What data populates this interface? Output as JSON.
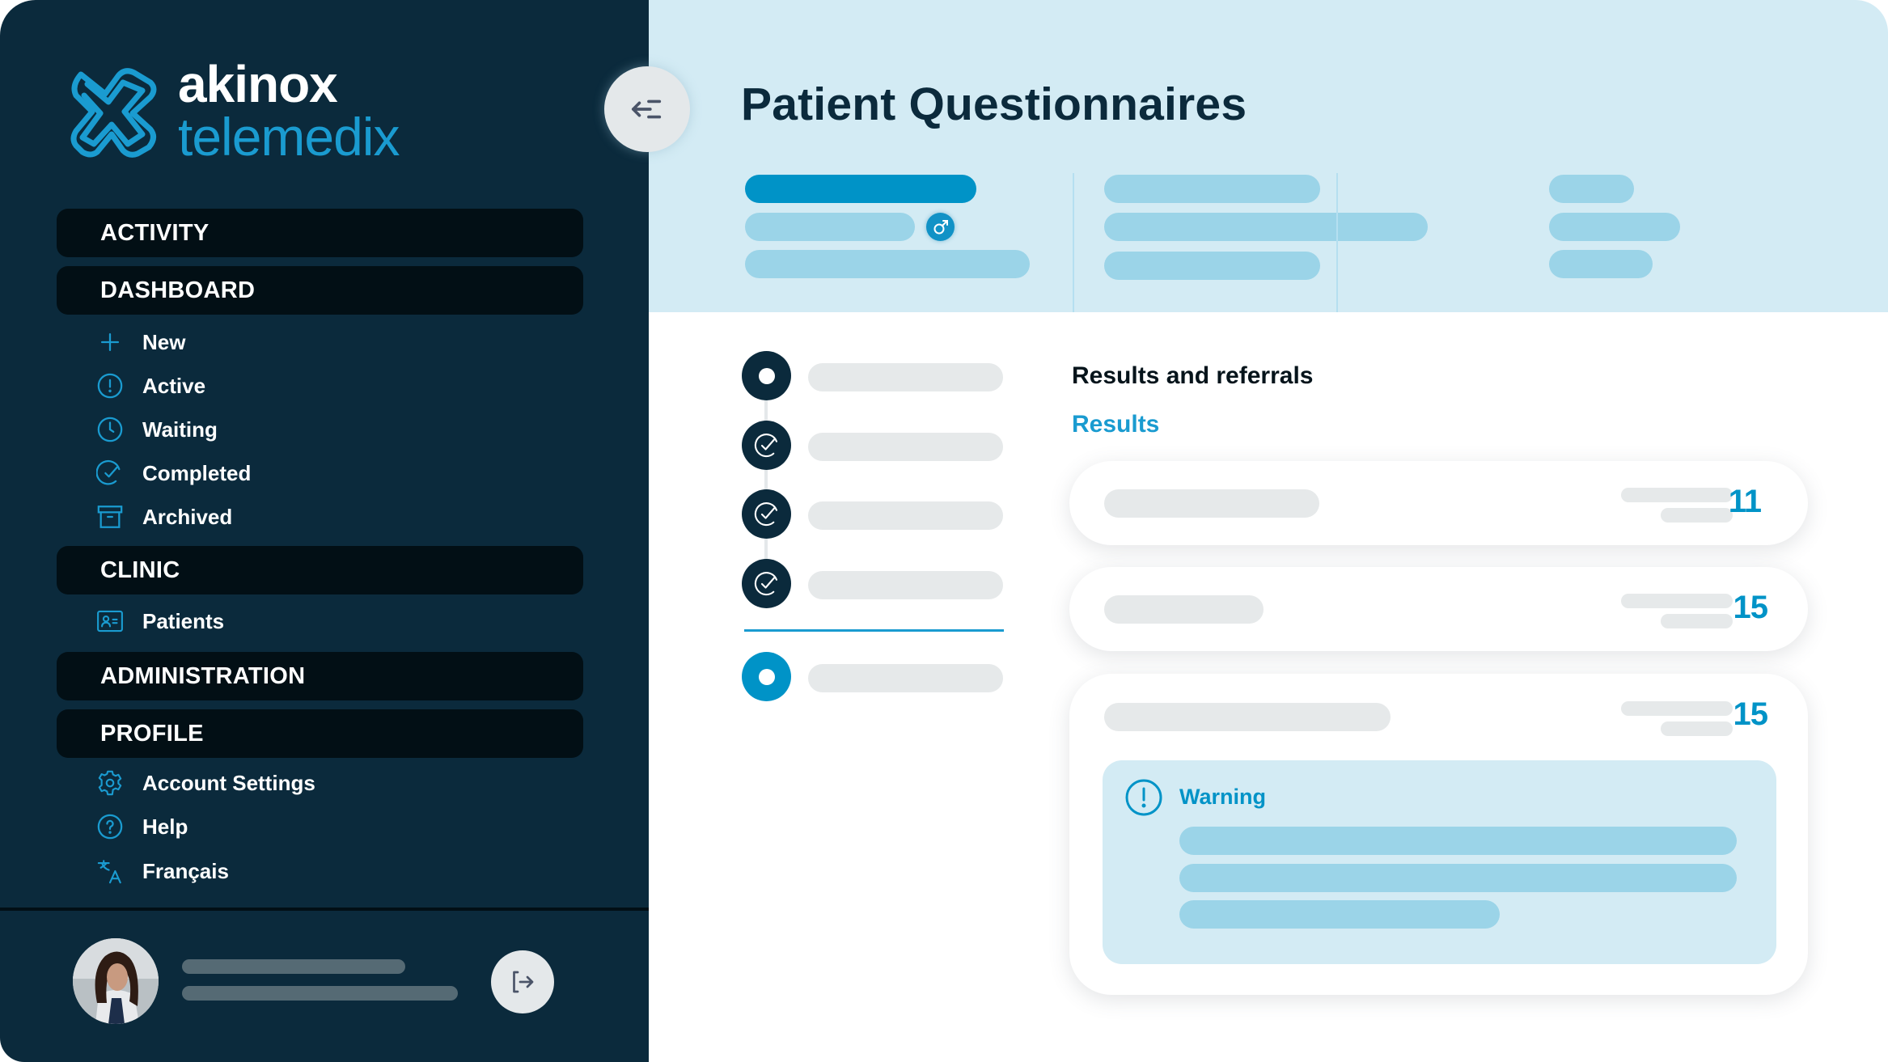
{
  "brand": {
    "name_line1": "akinox",
    "name_line2": "telemedix",
    "accent_color": "#1a9bd0",
    "dark_color": "#0b2a3c"
  },
  "sidebar": {
    "sections": [
      {
        "label": "ACTIVITY",
        "items": []
      },
      {
        "label": "DASHBOARD",
        "items": [
          {
            "label": "New",
            "icon": "plus-icon"
          },
          {
            "label": "Active",
            "icon": "alert-circle-icon"
          },
          {
            "label": "Waiting",
            "icon": "clock-icon"
          },
          {
            "label": "Completed",
            "icon": "check-circle-icon"
          },
          {
            "label": "Archived",
            "icon": "archive-box-icon"
          }
        ]
      },
      {
        "label": "CLINIC",
        "items": [
          {
            "label": "Patients",
            "icon": "patient-card-icon"
          }
        ]
      },
      {
        "label": "ADMINISTRATION",
        "items": []
      },
      {
        "label": "PROFILE",
        "items": [
          {
            "label": "Account Settings",
            "icon": "gear-icon"
          },
          {
            "label": "Help",
            "icon": "help-circle-icon"
          },
          {
            "label": "Français",
            "icon": "translate-icon"
          }
        ]
      }
    ],
    "user": {
      "avatar": "avatar-photo",
      "logout_icon": "logout-icon"
    },
    "collapse_icon": "collapse-menu-icon"
  },
  "header": {
    "title": "Patient Questionnaires",
    "gender_icon": "male-symbol-icon",
    "gender_symbol": "♂"
  },
  "stepper": {
    "steps": [
      {
        "state": "active-start"
      },
      {
        "state": "completed"
      },
      {
        "state": "completed"
      },
      {
        "state": "completed"
      },
      {
        "state": "current"
      }
    ]
  },
  "results": {
    "section_title": "Results and referrals",
    "subtitle": "Results",
    "cards": [
      {
        "score": "11",
        "has_warning": false
      },
      {
        "score": "15",
        "has_warning": false
      },
      {
        "score": "15",
        "has_warning": true,
        "warning_label": "Warning"
      }
    ]
  }
}
